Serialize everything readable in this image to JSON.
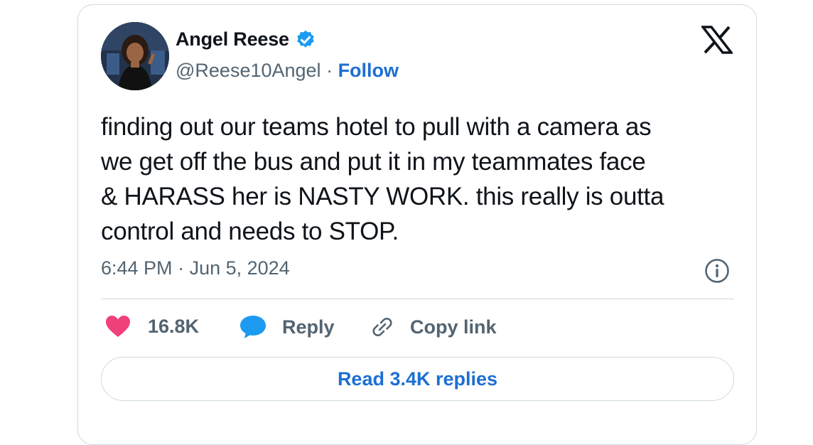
{
  "author": {
    "name": "Angel Reese",
    "handle": "@Reese10Angel",
    "separator": "·",
    "follow_label": "Follow",
    "avatar_icon": "profile-photo",
    "verified_icon": "verified-badge-icon",
    "verified_color": "#1d9bf0"
  },
  "brand": {
    "logo_icon": "x-logo-icon"
  },
  "tweet": {
    "lines": [
      "finding out our teams hotel to pull with a camera as",
      "we get off the bus and put it in my teammates face",
      "& HARASS her is NASTY WORK. this really is outta",
      "control and needs to STOP."
    ],
    "time": "6:44 PM",
    "separator": "·",
    "date": "Jun 5, 2024"
  },
  "actions": {
    "like_count": "16.8K",
    "like_icon": "heart-icon",
    "like_color": "#f0407a",
    "reply_label": "Reply",
    "reply_icon": "speech-bubble-icon",
    "reply_color": "#1d9bf0",
    "copy_label": "Copy link",
    "copy_icon": "link-icon",
    "info_icon": "info-icon"
  },
  "footer": {
    "read_replies_label": "Read 3.4K replies"
  },
  "colors": {
    "link": "#1d6fd1",
    "muted": "#536471",
    "border": "#cfd9de"
  }
}
